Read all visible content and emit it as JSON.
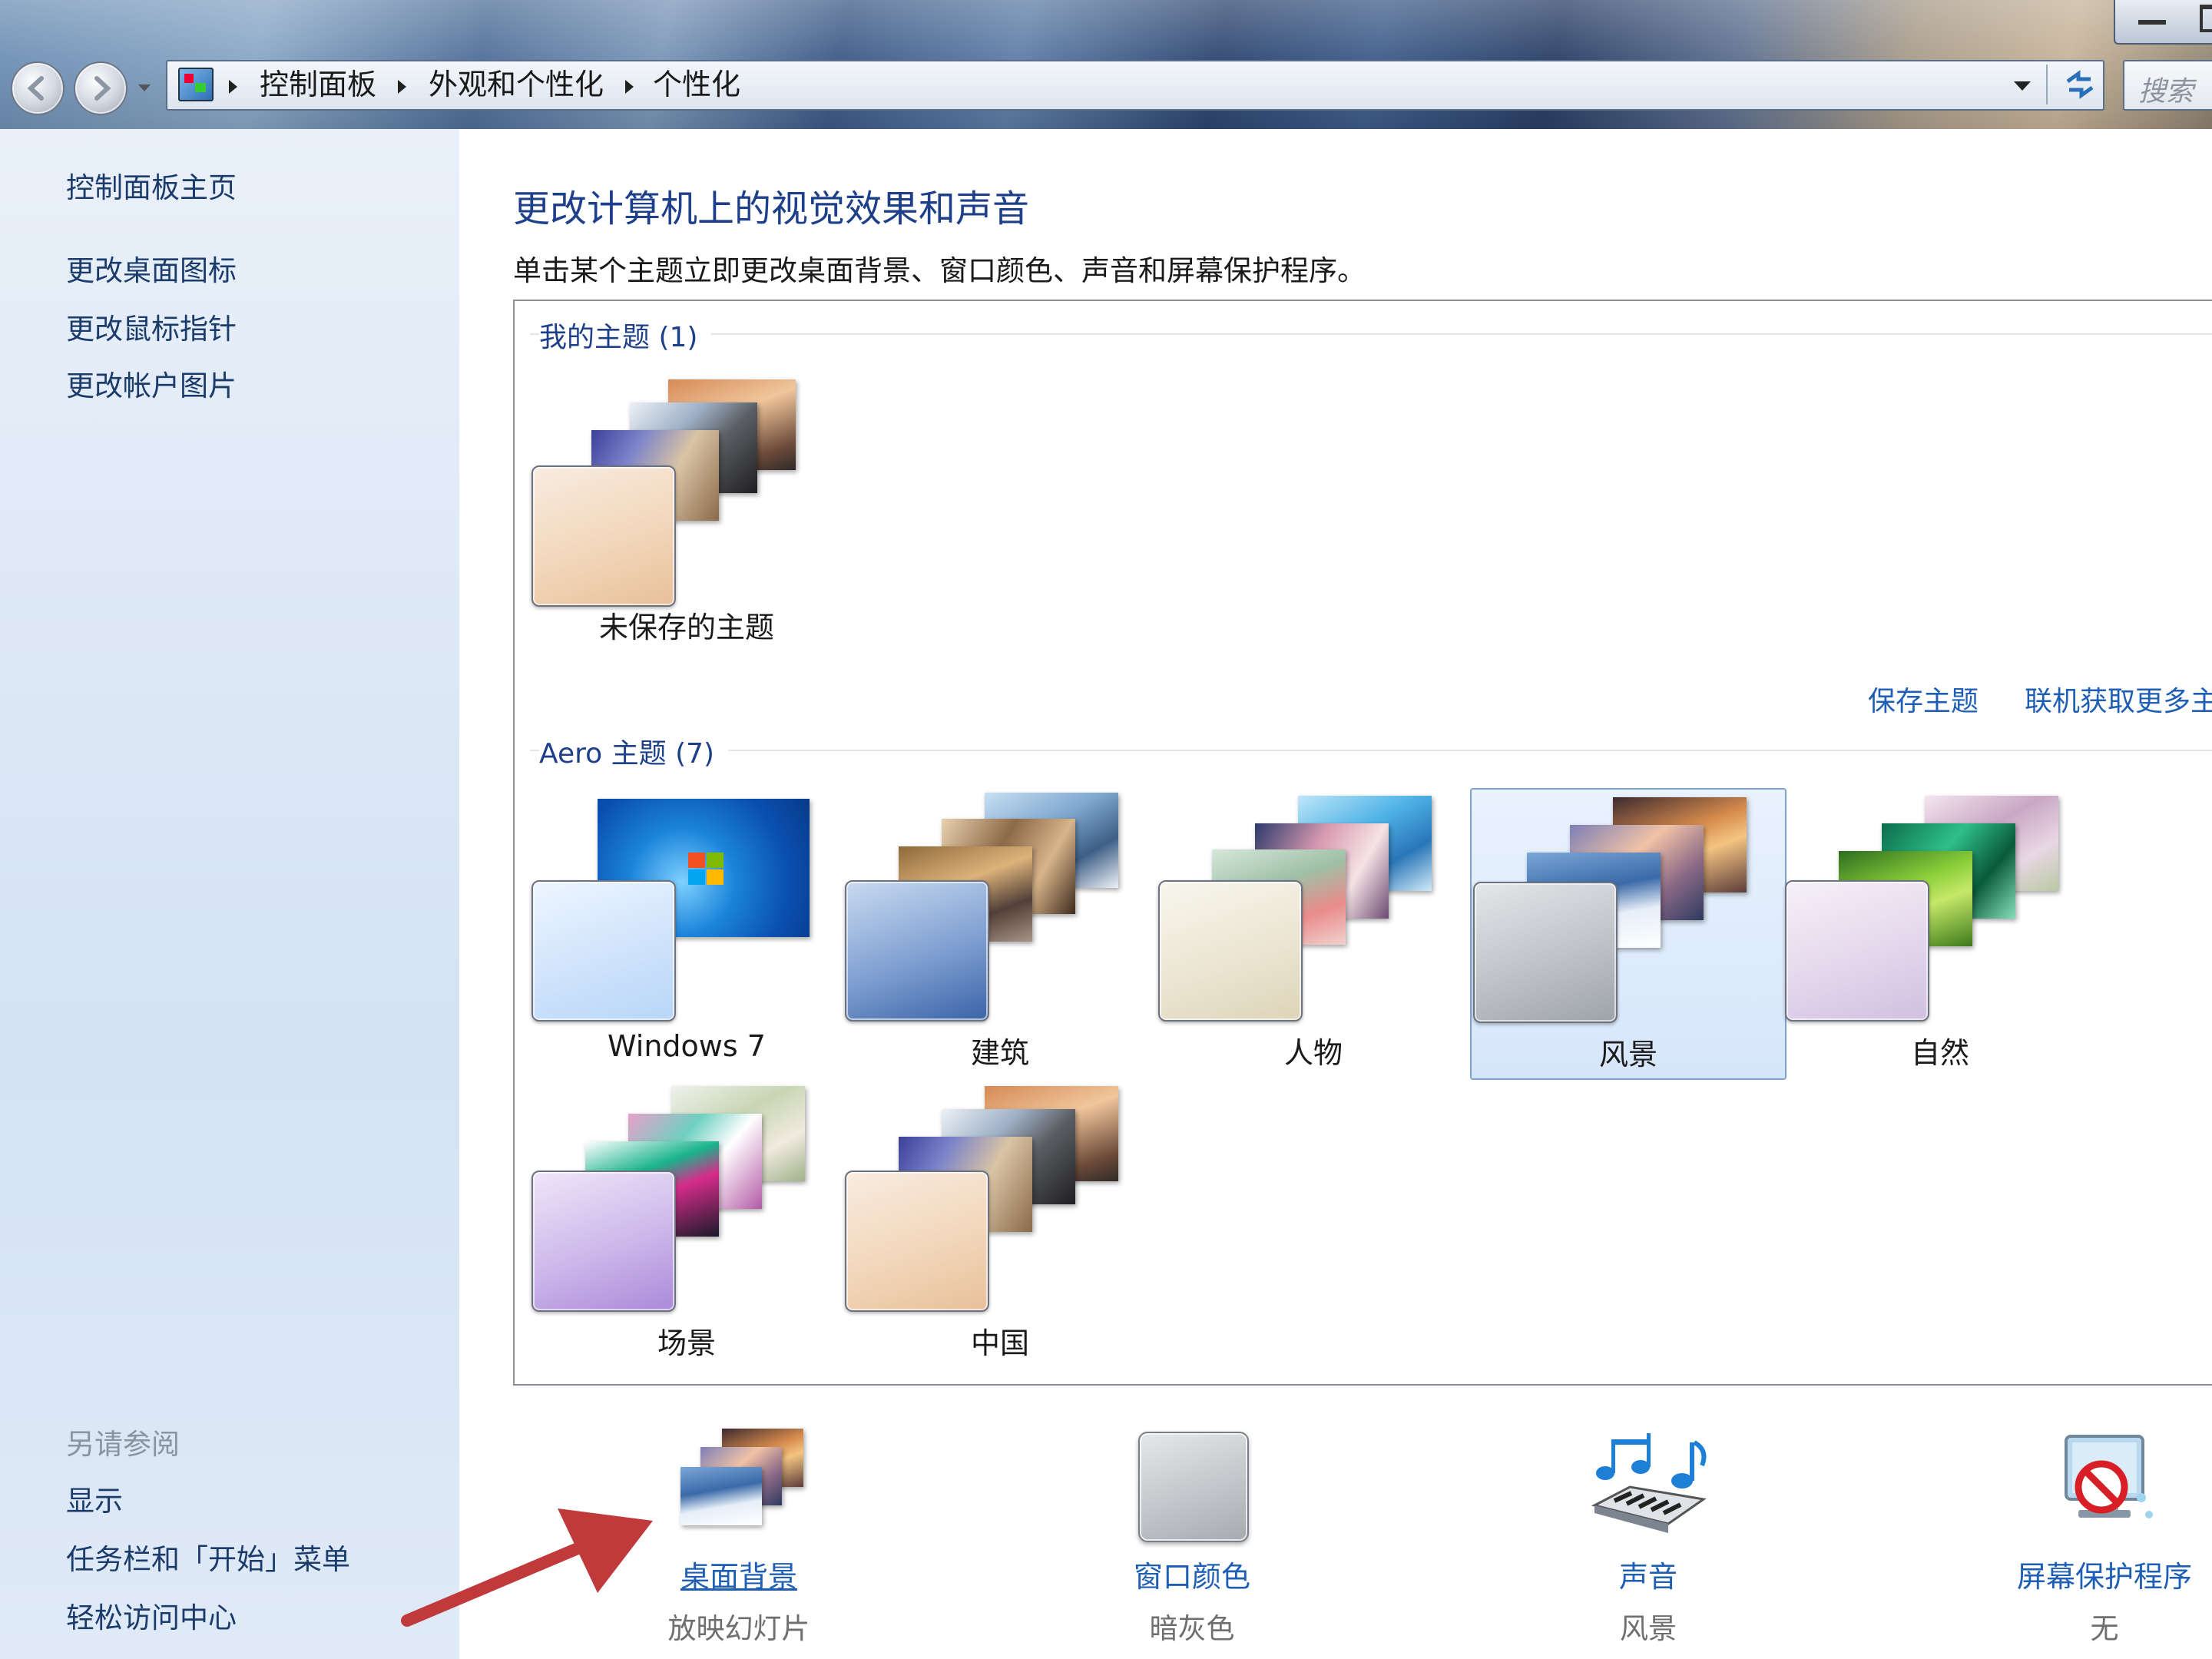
{
  "breadcrumb": {
    "items": [
      "控制面板",
      "外观和个性化",
      "个性化"
    ]
  },
  "search": {
    "placeholder": "搜索"
  },
  "sidebar": {
    "home": "控制面板主页",
    "links": [
      "更改桌面图标",
      "更改鼠标指针",
      "更改帐户图片"
    ],
    "see_also_title": "另请参阅",
    "see_also": [
      "显示",
      "任务栏和「开始」菜单",
      "轻松访问中心"
    ]
  },
  "main": {
    "title": "更改计算机上的视觉效果和声音",
    "description": "单击某个主题立即更改桌面背景、窗口颜色、声音和屏幕保护程序。",
    "my_themes": {
      "label": "我的主题 (1)",
      "items": [
        {
          "label": "未保存的主题"
        }
      ],
      "save_link": "保存主题",
      "online_link": "联机获取更多主"
    },
    "aero_themes": {
      "label": "Aero 主题 (7)",
      "items": [
        {
          "label": "Windows 7"
        },
        {
          "label": "建筑"
        },
        {
          "label": "人物"
        },
        {
          "label": "风景",
          "selected": true
        },
        {
          "label": "自然"
        },
        {
          "label": "场景"
        },
        {
          "label": "中国"
        }
      ]
    }
  },
  "settings": [
    {
      "label": "桌面背景",
      "value": "放映幻灯片"
    },
    {
      "label": "窗口颜色",
      "value": "暗灰色"
    },
    {
      "label": "声音",
      "value": "风景"
    },
    {
      "label": "屏幕保护程序",
      "value": "无"
    }
  ],
  "colors": {
    "link": "#1e5fb5",
    "heading": "#1e3f8a",
    "annotation_arrow": "#c0393b",
    "selection_bg": "#d6e6fa"
  },
  "icons": [
    "back-arrow-icon",
    "forward-arrow-icon",
    "control-panel-icon",
    "refresh-icon",
    "dropdown-icon",
    "sound-notes-icon",
    "screensaver-icon",
    "annotation-arrow"
  ]
}
